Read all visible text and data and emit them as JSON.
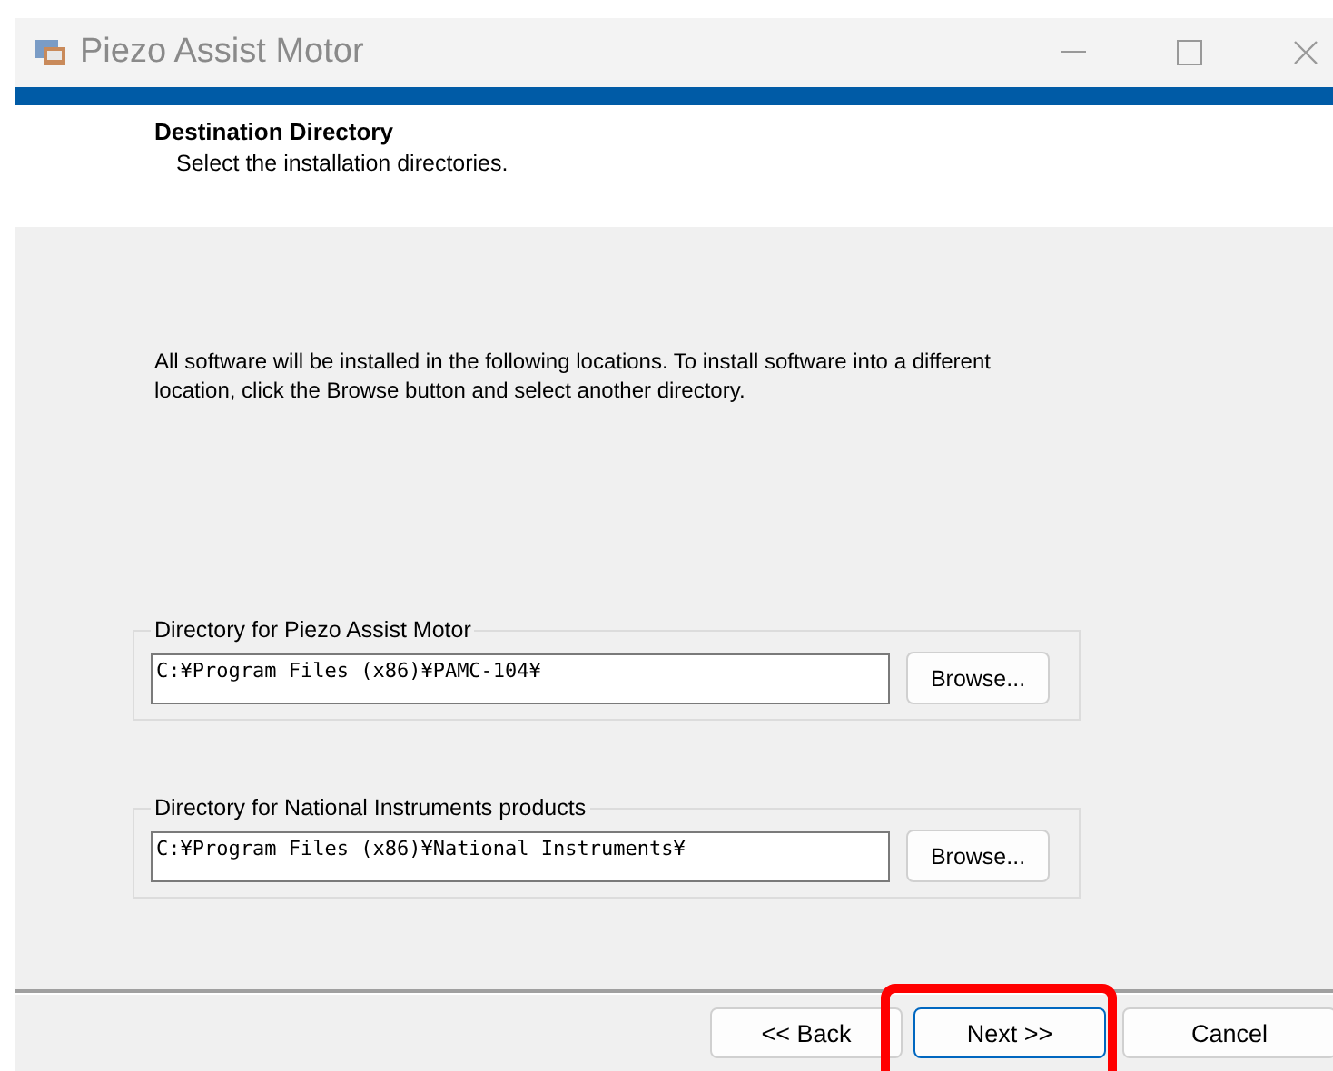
{
  "window": {
    "title": "Piezo Assist Motor"
  },
  "header": {
    "title": "Destination Directory",
    "subtitle": "Select the installation directories."
  },
  "description": "All software will be installed in the following locations. To install software into a different location, click the Browse button and select another directory.",
  "groups": [
    {
      "label": "Directory for Piezo Assist Motor",
      "value": "C:¥Program Files (x86)¥PAMC-104¥",
      "button": "Browse..."
    },
    {
      "label": "Directory for National Instruments products",
      "value": "C:¥Program Files (x86)¥National Instruments¥",
      "button": "Browse..."
    }
  ],
  "buttons": [
    {
      "label": "<< Back",
      "highlighted": false
    },
    {
      "label": "Next >>",
      "highlighted": true
    },
    {
      "label": "Cancel",
      "highlighted": false
    }
  ]
}
